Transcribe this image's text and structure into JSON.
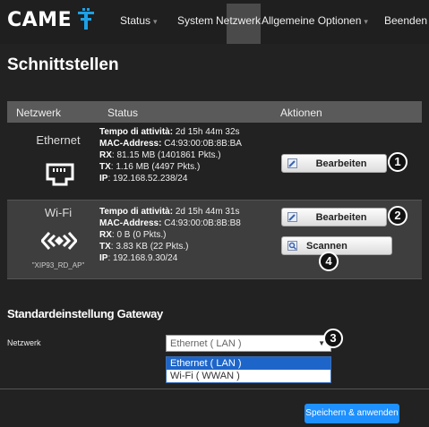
{
  "brand": {
    "name": "CAME"
  },
  "nav": {
    "items": [
      {
        "label": "Status",
        "caret": "▾"
      },
      {
        "label": "System"
      },
      {
        "label": "Netzwerk"
      },
      {
        "label": "Allgemeine Optionen",
        "caret": "▾"
      },
      {
        "label": "Beenden"
      }
    ]
  },
  "page": {
    "title": "Schnittstellen"
  },
  "table": {
    "headers": {
      "network": "Netzwerk",
      "status": "Status",
      "actions": "Aktionen"
    },
    "rows": [
      {
        "name": "Ethernet",
        "ssid": "",
        "status": [
          {
            "label": "Tempo di attività:",
            "value": " 2d 15h 44m 32s"
          },
          {
            "label": "MAC-Address:",
            "value": " C4:93:00:0B:8B:BA"
          },
          {
            "label": "RX",
            "value": ": 81.15 MB (1401861 Pkts.)"
          },
          {
            "label": "TX",
            "value": ": 1.16 MB (4497 Pkts.)"
          },
          {
            "label": "IP",
            "value": ": 192.168.52.238/24"
          }
        ],
        "edit_label": "Bearbeiten",
        "badge": "1"
      },
      {
        "name": "Wi-Fi",
        "ssid": "\"XIP93_RD_AP\"",
        "status": [
          {
            "label": "Tempo di attività:",
            "value": " 2d 15h 44m 31s"
          },
          {
            "label": "MAC-Address:",
            "value": " C4:93:00:0B:8B:B8"
          },
          {
            "label": "RX",
            "value": ": 0 B (0 Pkts.)"
          },
          {
            "label": "TX",
            "value": ": 3.83 KB (22 Pkts.)"
          },
          {
            "label": "IP",
            "value": ": 192.168.9.30/24"
          }
        ],
        "edit_label": "Bearbeiten",
        "scan_label": "Scannen",
        "badge": "2",
        "scan_badge": "4"
      }
    ]
  },
  "gateway": {
    "title": "Standardeinstellung Gateway",
    "field_label": "Netzwerk",
    "selected": "Ethernet ( LAN )",
    "badge": "3",
    "options": [
      "Ethernet ( LAN )",
      "Wi-Fi ( WWAN )"
    ]
  },
  "save_label": "Speichern & anwenden",
  "colors": {
    "accent": "#1e90ff",
    "brand_icon": "#1ea0e6",
    "selection": "#1e65c9"
  }
}
